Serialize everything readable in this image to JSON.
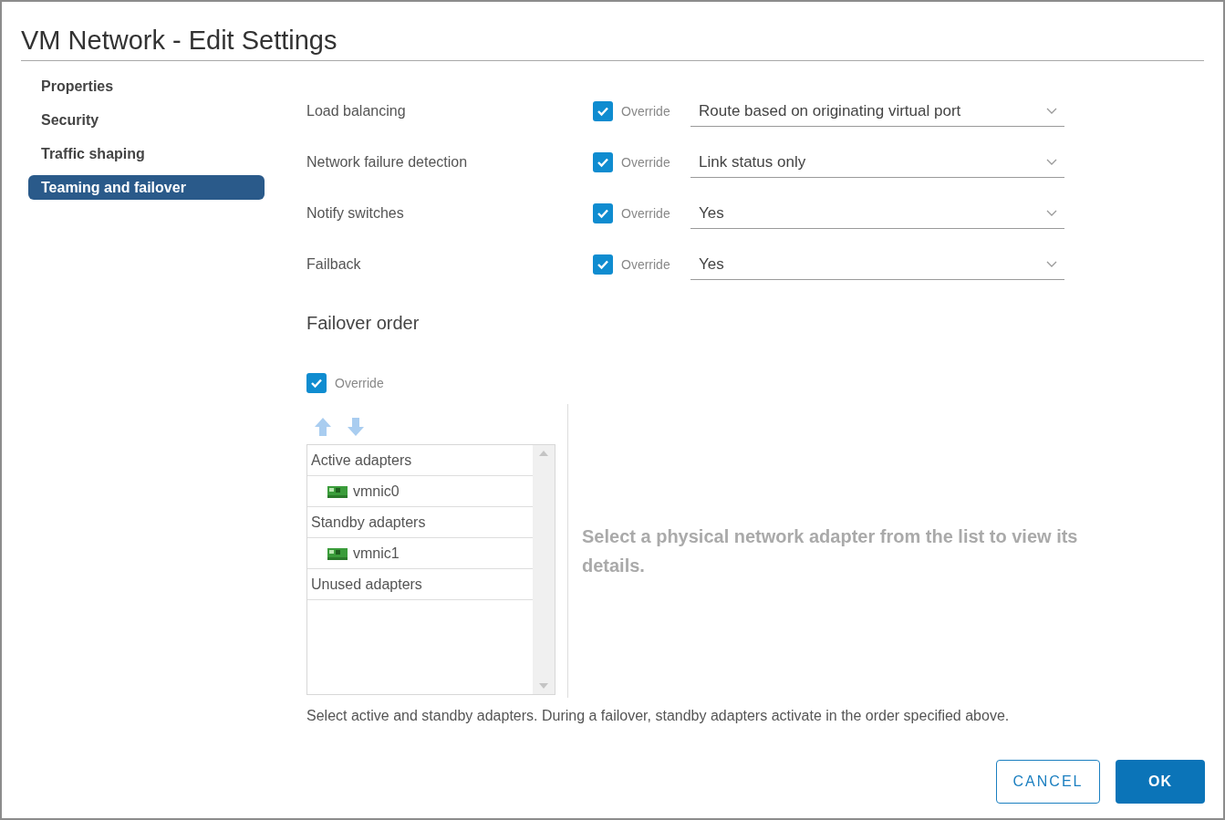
{
  "window": {
    "title": "VM Network - Edit Settings"
  },
  "sidebar": {
    "items": [
      {
        "label": "Properties",
        "selected": false
      },
      {
        "label": "Security",
        "selected": false
      },
      {
        "label": "Traffic shaping",
        "selected": false
      },
      {
        "label": "Teaming and failover",
        "selected": true
      }
    ]
  },
  "settings": [
    {
      "label": "Load balancing",
      "override": {
        "label": "Override",
        "checked": true
      },
      "value": "Route based on originating virtual port"
    },
    {
      "label": "Network failure detection",
      "override": {
        "label": "Override",
        "checked": true
      },
      "value": "Link status only"
    },
    {
      "label": "Notify switches",
      "override": {
        "label": "Override",
        "checked": true
      },
      "value": "Yes"
    },
    {
      "label": "Failback",
      "override": {
        "label": "Override",
        "checked": true
      },
      "value": "Yes"
    }
  ],
  "failover_order": {
    "title": "Failover order",
    "override": {
      "label": "Override",
      "checked": true
    },
    "adapters": [
      {
        "kind": "group",
        "label": "Active adapters"
      },
      {
        "kind": "adapter",
        "label": "vmnic0"
      },
      {
        "kind": "group",
        "label": "Standby adapters"
      },
      {
        "kind": "adapter",
        "label": "vmnic1"
      },
      {
        "kind": "group",
        "label": "Unused adapters"
      }
    ],
    "details_hint": "Select a physical network adapter from the list to view its details.",
    "note": "Select active and standby adapters. During a failover, standby adapters activate in the order specified above."
  },
  "buttons": [
    {
      "kind": "secondary",
      "label": "CANCEL"
    },
    {
      "kind": "primary",
      "label": "OK"
    }
  ]
}
